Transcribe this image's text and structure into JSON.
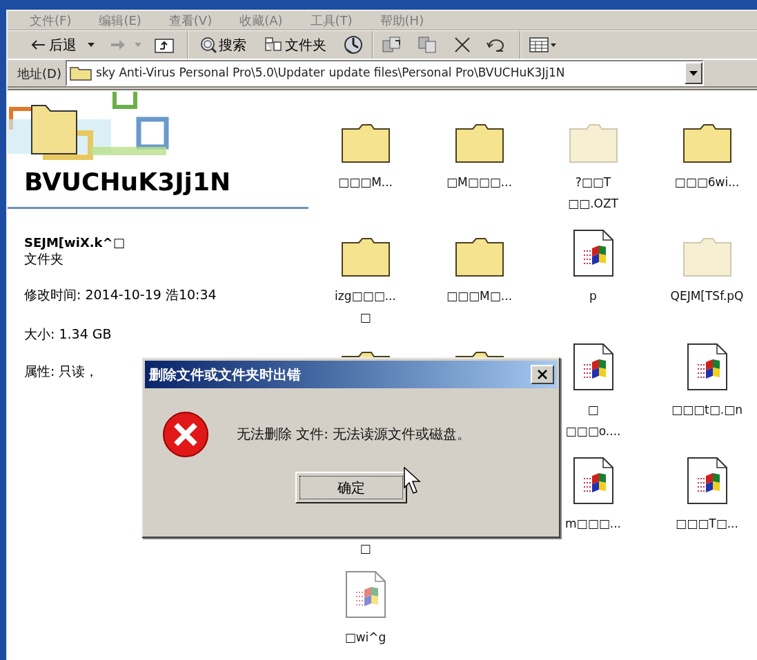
{
  "menu": [
    "文件(F)",
    "编辑(E)",
    "查看(V)",
    "收藏(A)",
    "工具(T)",
    "帮助(H)"
  ],
  "toolbar": {
    "back": "后退",
    "search": "搜索",
    "folders": "文件夹"
  },
  "address": {
    "label": "地址(D)",
    "value": "sky Anti-Virus Personal Pro\\5.0\\Updater update files\\Personal Pro\\BVUCHuK3Jj1N"
  },
  "details": {
    "title": "BVUCHuK3Jj1N",
    "name": "SEJM[wiX.k^□",
    "type": "文件夹",
    "modified": "修改时间: 2014-10-19 浩10:34",
    "size": "大小: 1.34 GB",
    "attributes": "属性: 只读，"
  },
  "icon_rows": [
    [
      {
        "kind": "folder",
        "label": "□□□M...",
        "hidden": false
      },
      {
        "kind": "folder",
        "label": "□M□□□...",
        "hidden": false
      },
      {
        "kind": "folder",
        "label": "?□□T\n□□.OZT",
        "hidden": true
      },
      {
        "kind": "folder",
        "label": "□□□6wi...",
        "hidden": false
      }
    ],
    [
      {
        "kind": "folder",
        "label": "izg□□□...\n□",
        "hidden": false
      },
      {
        "kind": "folder",
        "label": "□□□M□...",
        "hidden": false
      },
      {
        "kind": "file",
        "label": "p",
        "hidden": false
      },
      {
        "kind": "folder",
        "label": "QEJM[TSf.pQ",
        "hidden": true
      }
    ],
    [
      {
        "kind": "folder",
        "hidden": false
      },
      {
        "kind": "folder",
        "hidden": false
      },
      {
        "kind": "file",
        "label": "□\n□□□o....",
        "hidden": false
      },
      {
        "kind": "file",
        "label": "□□□t□.□n",
        "hidden": false
      }
    ],
    [
      {
        "kind": "covered",
        "label": "□"
      },
      {
        "kind": "covered"
      },
      {
        "kind": "file",
        "label": "m□□□...",
        "hidden": false
      },
      {
        "kind": "file",
        "label": "□□□T□...",
        "hidden": false
      }
    ],
    [
      {
        "kind": "file",
        "label": "□wi^g",
        "hidden": true
      }
    ]
  ],
  "dialog": {
    "title": "删除文件或文件夹时出错",
    "message": "无法删除 文件: 无法读源文件或磁盘。",
    "button": "确定"
  }
}
